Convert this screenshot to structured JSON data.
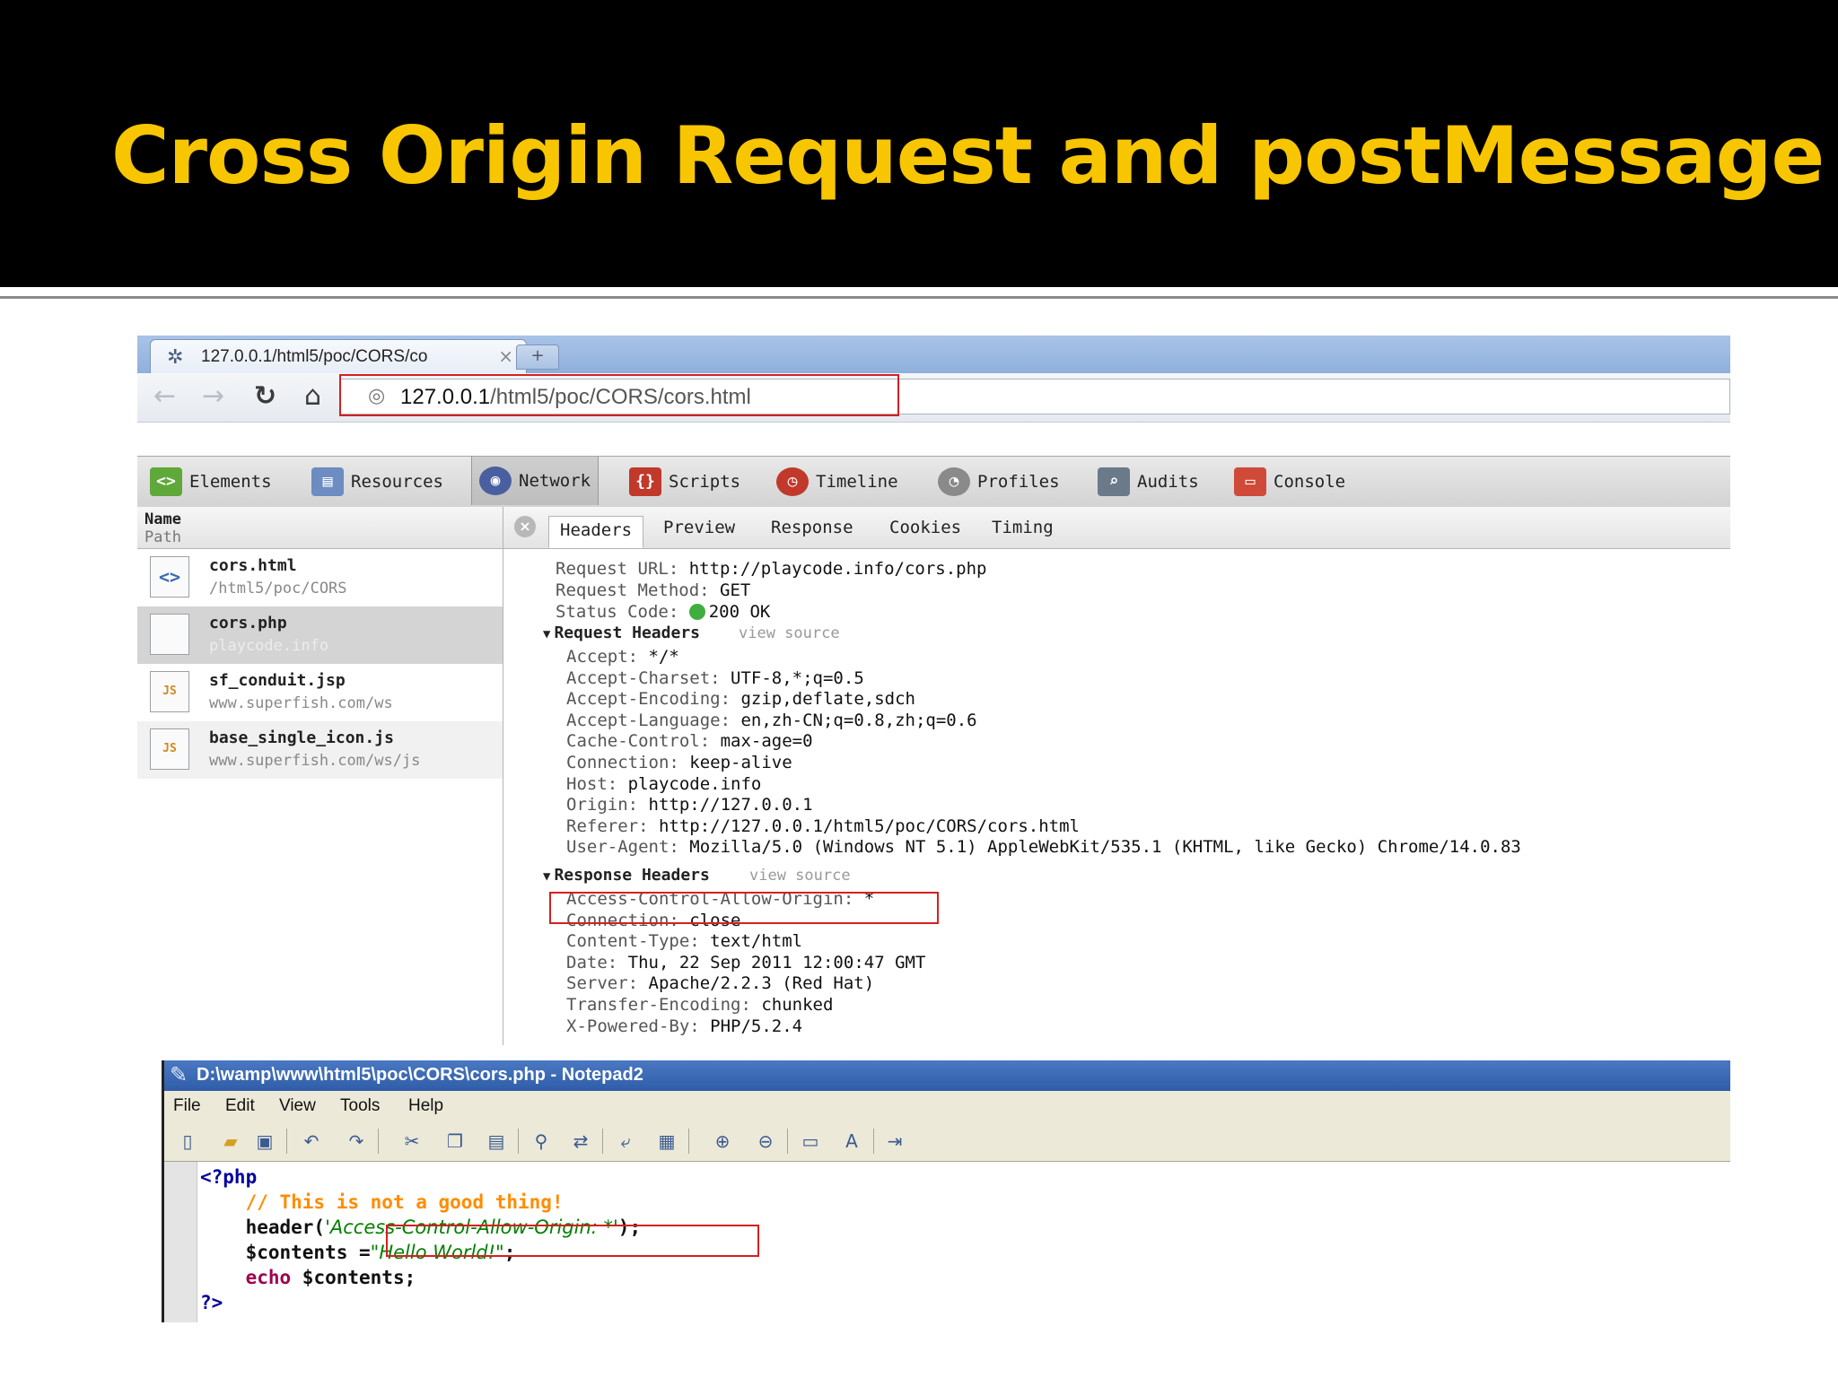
{
  "slide": {
    "title": "Cross Origin Request and postMessage"
  },
  "browser": {
    "tab_title": "127.0.0.1/html5/poc/CORS/co",
    "tab_close": "×",
    "new_tab": "+",
    "url_host": "127.0.0.1",
    "url_path": "/html5/poc/CORS/cors.html"
  },
  "devtools": {
    "tabs": [
      {
        "label": "Elements",
        "icon": "elements-icon",
        "color": "#5fa83a"
      },
      {
        "label": "Resources",
        "icon": "resources-icon",
        "color": "#6c8cc2"
      },
      {
        "label": "Network",
        "icon": "network-icon",
        "color": "#4a5fa0"
      },
      {
        "label": "Scripts",
        "icon": "scripts-icon",
        "color": "#c0392b"
      },
      {
        "label": "Timeline",
        "icon": "timeline-icon",
        "color": "#c0392b"
      },
      {
        "label": "Profiles",
        "icon": "profiles-icon",
        "color": "#8a8a8a"
      },
      {
        "label": "Audits",
        "icon": "audits-icon",
        "color": "#6a7a8a"
      },
      {
        "label": "Console",
        "icon": "console-icon",
        "color": "#d04a3a"
      }
    ],
    "columns": {
      "name": "Name",
      "path": "Path"
    },
    "requests": [
      {
        "name": "cors.html",
        "path": "/html5/poc/CORS",
        "icon": "<>"
      },
      {
        "name": "cors.php",
        "path": "playcode.info",
        "icon": ""
      },
      {
        "name": "sf_conduit.jsp",
        "path": "www.superfish.com/ws",
        "icon": "JS"
      },
      {
        "name": "base_single_icon.js",
        "path": "www.superfish.com/ws/js",
        "icon": "JS"
      }
    ],
    "subtabs": [
      "Headers",
      "Preview",
      "Response",
      "Cookies",
      "Timing"
    ],
    "general": [
      {
        "key": "Request URL:",
        "value": "http://playcode.info/cors.php"
      },
      {
        "key": "Request Method:",
        "value": "GET"
      },
      {
        "key": "Status Code:",
        "value": "200 OK"
      }
    ],
    "request_headers_title": "Request Headers",
    "view_source": "view source",
    "request_headers": [
      {
        "key": "Accept:",
        "value": "*/*"
      },
      {
        "key": "Accept-Charset:",
        "value": "UTF-8,*;q=0.5"
      },
      {
        "key": "Accept-Encoding:",
        "value": "gzip,deflate,sdch"
      },
      {
        "key": "Accept-Language:",
        "value": "en,zh-CN;q=0.8,zh;q=0.6"
      },
      {
        "key": "Cache-Control:",
        "value": "max-age=0"
      },
      {
        "key": "Connection:",
        "value": "keep-alive"
      },
      {
        "key": "Host:",
        "value": "playcode.info"
      },
      {
        "key": "Origin:",
        "value": "http://127.0.0.1"
      },
      {
        "key": "Referer:",
        "value": "http://127.0.0.1/html5/poc/CORS/cors.html"
      },
      {
        "key": "User-Agent:",
        "value": "Mozilla/5.0 (Windows NT 5.1) AppleWebKit/535.1 (KHTML, like Gecko) Chrome/14.0.83"
      }
    ],
    "response_headers_title": "Response Headers",
    "response_headers": [
      {
        "key": "Access-Control-Allow-Origin:",
        "value": "*"
      },
      {
        "key": "Connection:",
        "value": "close"
      },
      {
        "key": "Content-Type:",
        "value": "text/html"
      },
      {
        "key": "Date:",
        "value": "Thu, 22 Sep 2011 12:00:47 GMT"
      },
      {
        "key": "Server:",
        "value": "Apache/2.2.3 (Red Hat)"
      },
      {
        "key": "Transfer-Encoding:",
        "value": "chunked"
      },
      {
        "key": "X-Powered-By:",
        "value": "PHP/5.2.4"
      }
    ]
  },
  "notepad": {
    "title": "D:\\wamp\\www\\html5\\poc\\CORS\\cors.php - Notepad2",
    "menu": [
      "File",
      "Edit",
      "View",
      "Tools",
      "Help"
    ],
    "code": {
      "line1": "<?php",
      "line2": "// This is not a good thing!",
      "line3_fn": "header(",
      "line3_str": "'Access-Control-Allow-Origin: *'",
      "line3_end": ");",
      "line4_var": "$contents =",
      "line4_str": "\"Hello World!\"",
      "line4_end": ";",
      "line5_kw": "echo",
      "line5_var": " $contents;",
      "line6": "?>"
    }
  },
  "colors": {
    "title": "#f7c600",
    "highlight": "#d42020"
  }
}
